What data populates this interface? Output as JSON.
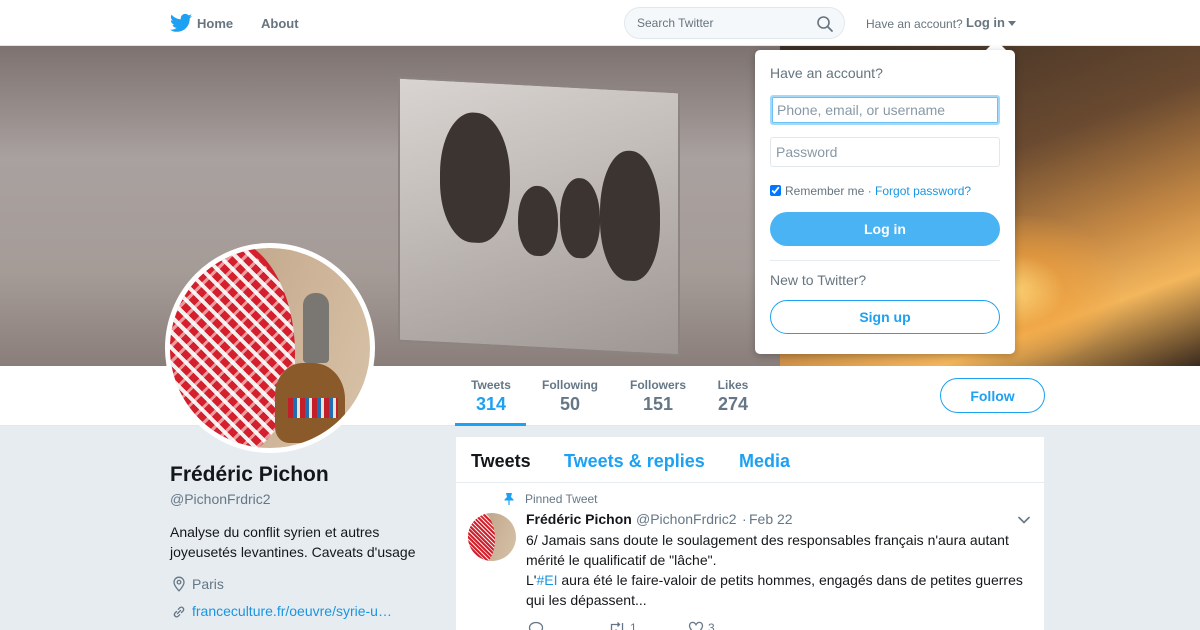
{
  "nav": {
    "home_label": "Home",
    "about_label": "About",
    "search_placeholder": "Search Twitter",
    "have_account": "Have an account?",
    "login_label": "Log in",
    "logo_icon": "twitter-bird-icon",
    "brand_color": "#1da1f2"
  },
  "login_dropdown": {
    "title": "Have an account?",
    "username_placeholder": "Phone, email, or username",
    "password_placeholder": "Password",
    "remember_label": "Remember me",
    "separator": "·",
    "forgot_label": "Forgot password?",
    "remember_checked": true,
    "login_button": "Log in",
    "new_label": "New to Twitter?",
    "signup_button": "Sign up"
  },
  "profile": {
    "name": "Frédéric Pichon",
    "handle": "@PichonFrdric2",
    "bio": "Analyse du conflit syrien et autres joyeusetés levantines. Caveats d'usage",
    "location": "Paris",
    "url": "franceculture.fr/oeuvre/syrie-u…"
  },
  "stats": [
    {
      "label": "Tweets",
      "value": "314"
    },
    {
      "label": "Following",
      "value": "50"
    },
    {
      "label": "Followers",
      "value": "151"
    },
    {
      "label": "Likes",
      "value": "274"
    }
  ],
  "follow_button": "Follow",
  "timeline": {
    "tabs": [
      "Tweets",
      "Tweets & replies",
      "Media"
    ],
    "active_tab": "Tweets",
    "pinned_label": "Pinned Tweet",
    "tweet": {
      "name": "Frédéric Pichon",
      "handle": "@PichonFrdric2",
      "dot": "·",
      "date": "Feb 22",
      "line1": "6/ Jamais sans doute le soulagement des responsables français n'aura autant mérité le qualificatif de \"lâche\".",
      "line2_prefix": "L'",
      "hashtag": "#EI",
      "line2_rest": " aura été le faire-valoir de petits hommes, engagés dans de petites guerres qui les dépassent...",
      "retweets": "1",
      "likes": "3"
    }
  }
}
